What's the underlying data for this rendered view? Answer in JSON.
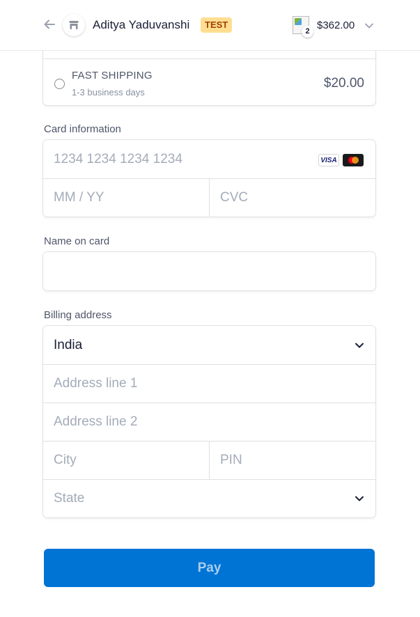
{
  "header": {
    "merchant_name": "Aditya Yaduvanshi",
    "test_badge": "TEST",
    "cart_count": "2",
    "total": "$362.00",
    "icons": {
      "back": "arrow-left-icon",
      "store": "store-icon",
      "expand": "chevron-down-icon"
    }
  },
  "shipping": {
    "option": {
      "name": "FAST SHIPPING",
      "description": "1-3 business days",
      "price": "$20.00",
      "selected": false
    }
  },
  "card": {
    "label": "Card information",
    "number_placeholder": "1234 1234 1234 1234",
    "expiry_placeholder": "MM / YY",
    "cvc_placeholder": "CVC",
    "brands": [
      "VISA",
      "mastercard"
    ]
  },
  "name_on_card": {
    "label": "Name on card",
    "value": ""
  },
  "billing": {
    "label": "Billing address",
    "country": "India",
    "address1_placeholder": "Address line 1",
    "address2_placeholder": "Address line 2",
    "city_placeholder": "City",
    "pin_placeholder": "PIN",
    "state_placeholder": "State"
  },
  "pay_button": {
    "label": "Pay"
  },
  "colors": {
    "accent": "#0074d4",
    "test_badge_bg": "#ffde92",
    "test_badge_text": "#a04100"
  }
}
